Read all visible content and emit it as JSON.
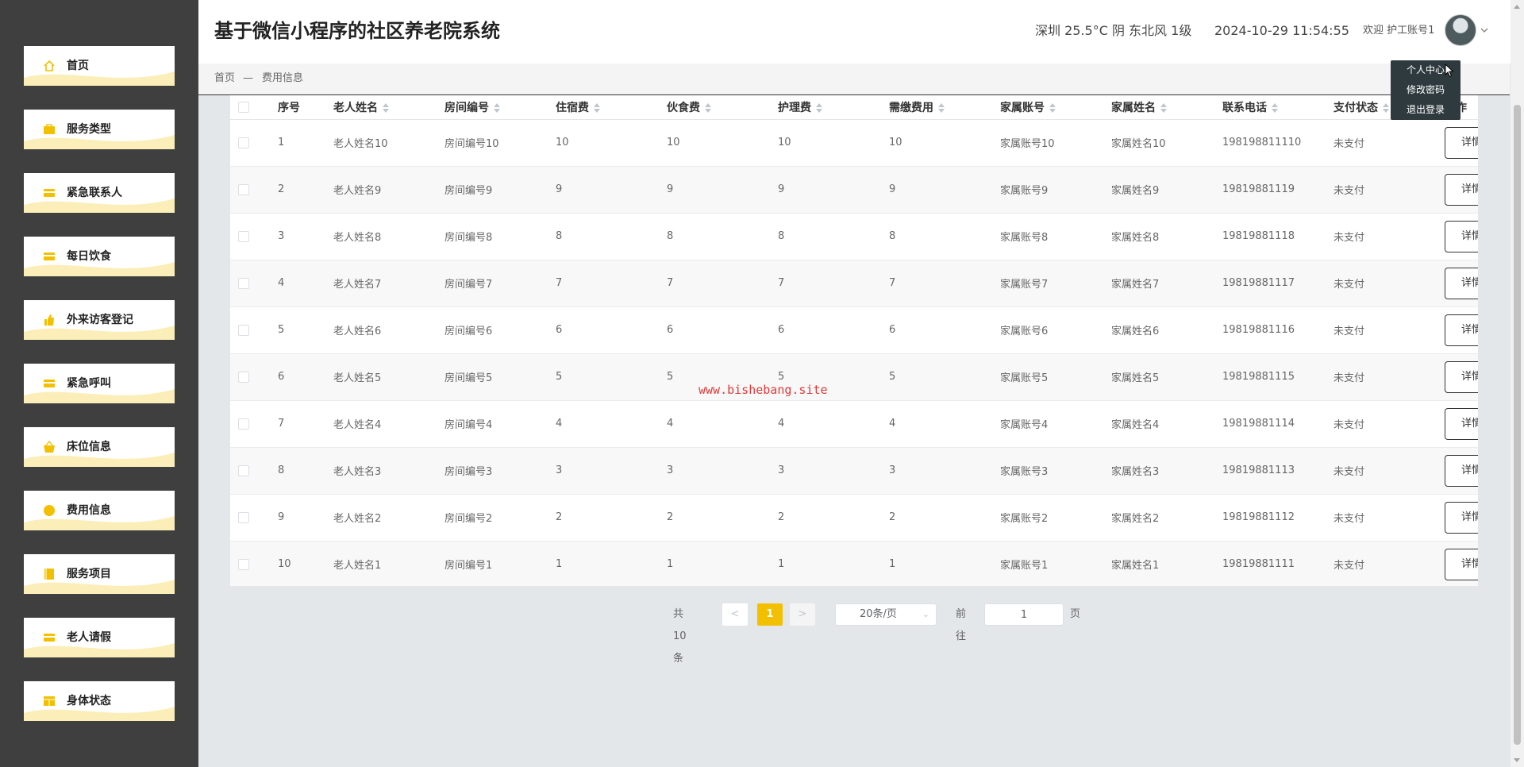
{
  "app": {
    "title": "基于微信小程序的社区养老院系统",
    "weather": "深圳 25.5°C 阴 东北风 1级",
    "datetime": "2024-10-29 11:54:55",
    "welcome": "欢迎 护工账号1"
  },
  "colors": {
    "accent": "#f2c000",
    "sidebar": "#3f3f3f",
    "menu_wave": "#fbeeb8"
  },
  "sidebar": {
    "items": [
      {
        "label": "首页",
        "icon": "home-icon"
      },
      {
        "label": "服务类型",
        "icon": "briefcase-icon"
      },
      {
        "label": "紧急联系人",
        "icon": "card-icon"
      },
      {
        "label": "每日饮食",
        "icon": "card-icon"
      },
      {
        "label": "外来访客登记",
        "icon": "thumb-up-icon"
      },
      {
        "label": "紧急呼叫",
        "icon": "card-icon"
      },
      {
        "label": "床位信息",
        "icon": "basket-icon"
      },
      {
        "label": "费用信息",
        "icon": "circle-icon"
      },
      {
        "label": "服务项目",
        "icon": "book-icon"
      },
      {
        "label": "老人请假",
        "icon": "card-icon"
      },
      {
        "label": "身体状态",
        "icon": "table-icon"
      }
    ]
  },
  "breadcrumb": {
    "home": "首页",
    "separator": "—",
    "current": "费用信息"
  },
  "user_menu": {
    "items": [
      "个人中心",
      "修改密码",
      "退出登录"
    ]
  },
  "table": {
    "headers": [
      "序号",
      "老人姓名",
      "房间编号",
      "住宿费",
      "伙食费",
      "护理费",
      "需缴费用",
      "家属账号",
      "家属姓名",
      "联系电话",
      "支付状态",
      "操作"
    ],
    "action_label": "详情",
    "rows": [
      [
        "1",
        "老人姓名10",
        "房间编号10",
        "10",
        "10",
        "10",
        "10",
        "家属账号10",
        "家属姓名10",
        "198198811110",
        "未支付"
      ],
      [
        "2",
        "老人姓名9",
        "房间编号9",
        "9",
        "9",
        "9",
        "9",
        "家属账号9",
        "家属姓名9",
        "19819881119",
        "未支付"
      ],
      [
        "3",
        "老人姓名8",
        "房间编号8",
        "8",
        "8",
        "8",
        "8",
        "家属账号8",
        "家属姓名8",
        "19819881118",
        "未支付"
      ],
      [
        "4",
        "老人姓名7",
        "房间编号7",
        "7",
        "7",
        "7",
        "7",
        "家属账号7",
        "家属姓名7",
        "19819881117",
        "未支付"
      ],
      [
        "5",
        "老人姓名6",
        "房间编号6",
        "6",
        "6",
        "6",
        "6",
        "家属账号6",
        "家属姓名6",
        "19819881116",
        "未支付"
      ],
      [
        "6",
        "老人姓名5",
        "房间编号5",
        "5",
        "5",
        "5",
        "5",
        "家属账号5",
        "家属姓名5",
        "19819881115",
        "未支付"
      ],
      [
        "7",
        "老人姓名4",
        "房间编号4",
        "4",
        "4",
        "4",
        "4",
        "家属账号4",
        "家属姓名4",
        "19819881114",
        "未支付"
      ],
      [
        "8",
        "老人姓名3",
        "房间编号3",
        "3",
        "3",
        "3",
        "3",
        "家属账号3",
        "家属姓名3",
        "19819881113",
        "未支付"
      ],
      [
        "9",
        "老人姓名2",
        "房间编号2",
        "2",
        "2",
        "2",
        "2",
        "家属账号2",
        "家属姓名2",
        "19819881112",
        "未支付"
      ],
      [
        "10",
        "老人姓名1",
        "房间编号1",
        "1",
        "1",
        "1",
        "1",
        "家属账号1",
        "家属姓名1",
        "19819881111",
        "未支付"
      ]
    ]
  },
  "pagination": {
    "total_text": "共 10 条",
    "prev": "<",
    "current_page": "1",
    "next": ">",
    "page_size": "20条/页",
    "goto_label": "前往",
    "goto_value": "1",
    "page_suffix": "页"
  },
  "watermark": "www.bishebang.site"
}
